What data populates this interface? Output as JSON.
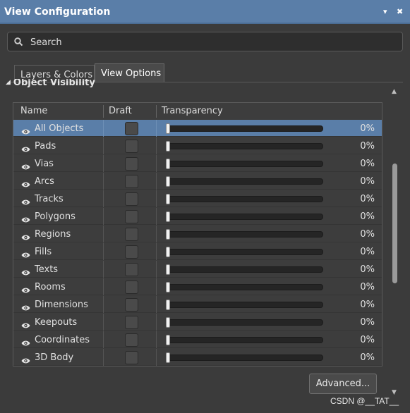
{
  "window": {
    "title": "View Configuration",
    "pin_glyph": "▾",
    "close_glyph": "✖"
  },
  "search": {
    "placeholder": "Search",
    "icon": "search-icon"
  },
  "tabs": [
    {
      "label": "Layers & Colors",
      "active": false
    },
    {
      "label": "View Options",
      "active": true
    }
  ],
  "section": {
    "label": "Object Visibility"
  },
  "table": {
    "headers": {
      "name": "Name",
      "draft": "Draft",
      "transparency": "Transparency"
    },
    "rows": [
      {
        "name": "All Objects",
        "transparency": "0%",
        "selected": true
      },
      {
        "name": "Pads",
        "transparency": "0%"
      },
      {
        "name": "Vias",
        "transparency": "0%"
      },
      {
        "name": "Arcs",
        "transparency": "0%"
      },
      {
        "name": "Tracks",
        "transparency": "0%"
      },
      {
        "name": "Polygons",
        "transparency": "0%"
      },
      {
        "name": "Regions",
        "transparency": "0%"
      },
      {
        "name": "Fills",
        "transparency": "0%"
      },
      {
        "name": "Texts",
        "transparency": "0%"
      },
      {
        "name": "Rooms",
        "transparency": "0%"
      },
      {
        "name": "Dimensions",
        "transparency": "0%"
      },
      {
        "name": "Keepouts",
        "transparency": "0%"
      },
      {
        "name": "Coordinates",
        "transparency": "0%"
      },
      {
        "name": "3D Body",
        "transparency": "0%"
      }
    ]
  },
  "buttons": {
    "advanced": "Advanced..."
  },
  "watermark": "CSDN @__TAT__",
  "colors": {
    "titlebar": "#5a7ea8",
    "selected_row": "#5a7ea8",
    "background": "#3b3b3b"
  }
}
